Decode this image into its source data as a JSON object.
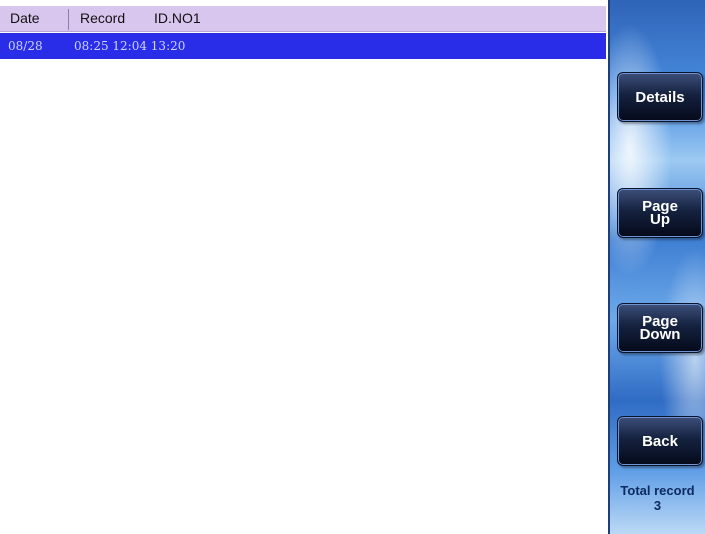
{
  "header": {
    "col_date": "Date",
    "col_record": "Record",
    "col_id": "ID.NO1"
  },
  "rows": [
    {
      "date": "08/28",
      "record": "08:25 12:04 13:20"
    }
  ],
  "sidebar": {
    "details_label": "Details",
    "page_up_line1": "Page",
    "page_up_line2": "Up",
    "page_down_line1": "Page",
    "page_down_line2": "Down",
    "back_label": "Back",
    "total_label": "Total record",
    "total_value": "3"
  },
  "colors": {
    "header_bg": "#d9c6ee",
    "selected_row_bg": "#2a2de8",
    "button_bg": "#0f1a34"
  }
}
